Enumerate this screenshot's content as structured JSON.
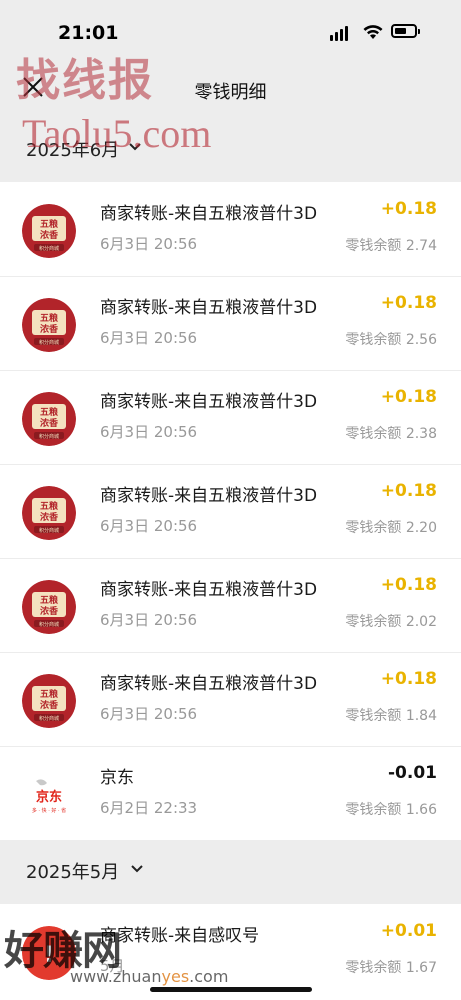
{
  "status_bar": {
    "time": "21:01"
  },
  "nav": {
    "title": "零钱明细"
  },
  "watermarks": {
    "top_cn": "找线报",
    "top_en": "Taolu5.com",
    "bottom_cn": "好赚网",
    "bottom_en_a": "www.zhuan",
    "bottom_en_b": "yes",
    "bottom_en_c": ".com"
  },
  "groups": [
    {
      "month": "2025年6月",
      "items": [
        {
          "title": "商家转账-来自五粮液普什3D",
          "date": "6月3日 20:56",
          "amount": "+0.18",
          "balance": "零钱余额 2.74",
          "avatar": "wuliangye-mall-logo"
        },
        {
          "title": "商家转账-来自五粮液普什3D",
          "date": "6月3日 20:56",
          "amount": "+0.18",
          "balance": "零钱余额 2.56",
          "avatar": "wuliangye-mall-logo"
        },
        {
          "title": "商家转账-来自五粮液普什3D",
          "date": "6月3日 20:56",
          "amount": "+0.18",
          "balance": "零钱余额 2.38",
          "avatar": "wuliangye-mall-logo"
        },
        {
          "title": "商家转账-来自五粮液普什3D",
          "date": "6月3日 20:56",
          "amount": "+0.18",
          "balance": "零钱余额 2.20",
          "avatar": "wuliangye-mall-logo"
        },
        {
          "title": "商家转账-来自五粮液普什3D",
          "date": "6月3日 20:56",
          "amount": "+0.18",
          "balance": "零钱余额 2.02",
          "avatar": "wuliangye-mall-logo"
        },
        {
          "title": "商家转账-来自五粮液普什3D",
          "date": "6月3日 20:56",
          "amount": "+0.18",
          "balance": "零钱余额 1.84",
          "avatar": "wuliangye-mall-logo"
        },
        {
          "title": "京东",
          "date": "6月2日 22:33",
          "amount": "-0.01",
          "balance": "零钱余额 1.66",
          "avatar": "jd-logo"
        }
      ]
    },
    {
      "month": "2025年5月",
      "items": [
        {
          "title": "商家转账-来自感叹号",
          "date": "5月",
          "amount": "+0.01",
          "balance": "零钱余额 1.67",
          "avatar": "merchant-logo"
        }
      ]
    }
  ],
  "colors": {
    "income": "#e9b300",
    "expense": "#111111",
    "background": "#ededed"
  }
}
